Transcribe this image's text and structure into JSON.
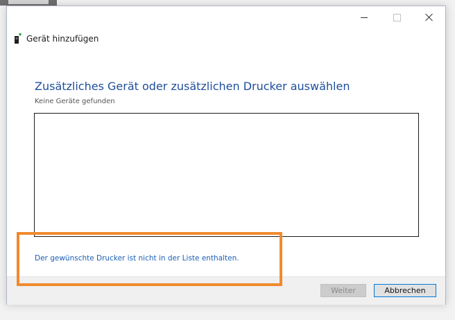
{
  "window": {
    "title": "Gerät hinzufügen",
    "title_icon": "add-device-icon",
    "controls": {
      "minimize_icon": "minimize-icon",
      "maximize_icon": "maximize-icon",
      "close_icon": "close-icon"
    }
  },
  "main": {
    "heading": "Zusätzliches Gerät oder zusätzlichen Drucker auswählen",
    "status": "Keine Geräte gefunden",
    "device_list": [],
    "printer_not_listed_link": "Der gewünschte Drucker ist nicht in der Liste enthalten."
  },
  "footer": {
    "next_label": "Weiter",
    "next_enabled": false,
    "cancel_label": "Abbrechen"
  },
  "colors": {
    "heading": "#1e4e9b",
    "link": "#1a5fb4",
    "highlight": "#f18a2e",
    "focus_border": "#0078d7"
  }
}
